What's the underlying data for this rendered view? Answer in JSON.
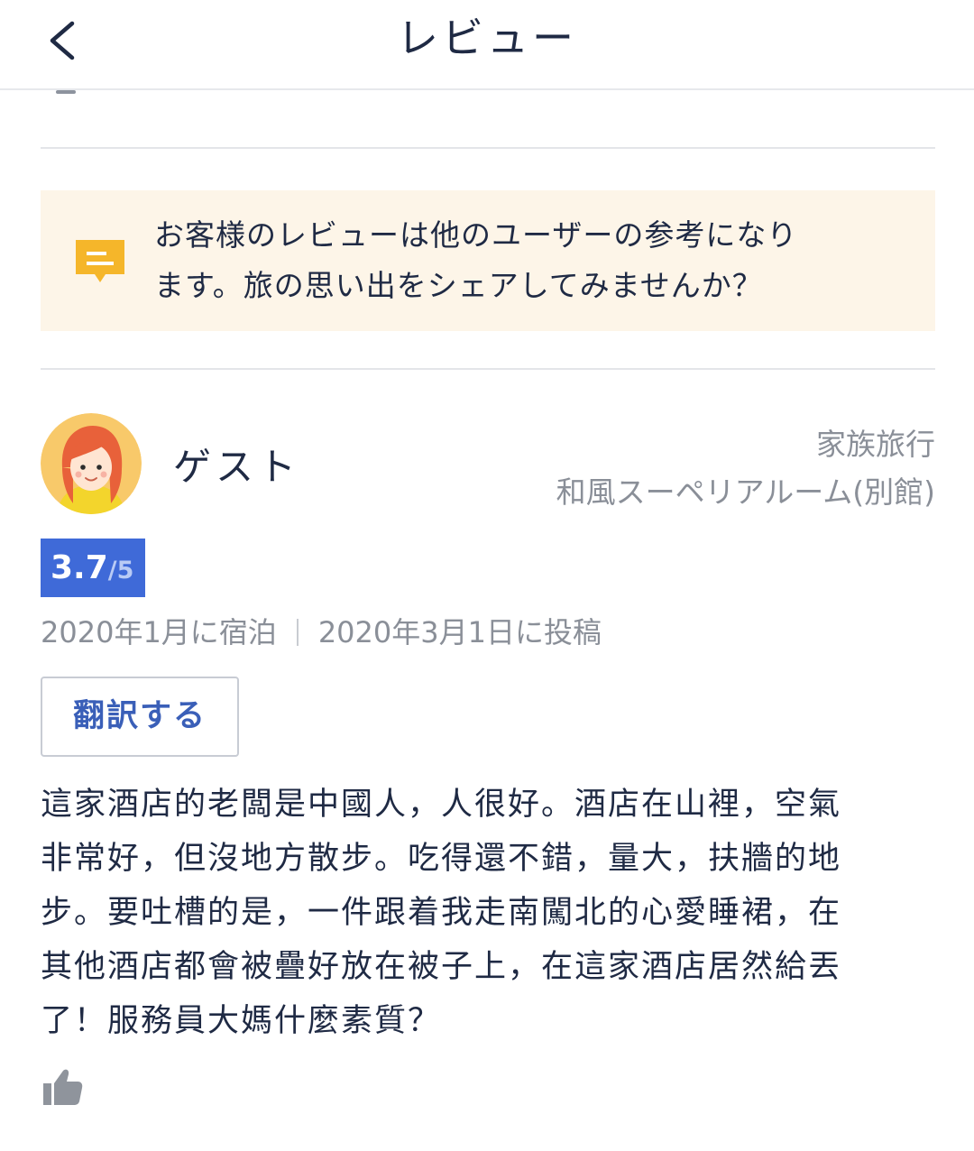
{
  "header": {
    "title": "レビュー",
    "back_icon": "chevron-left-icon"
  },
  "notice": {
    "icon": "message-icon",
    "icon_color": "#f5b62a",
    "background": "#fdf5e8",
    "line1": "お客様のレビューは他のユーザーの参考になり",
    "line2": "ます。旅の思い出をシェアしてみませんか？"
  },
  "review": {
    "user_name": "ゲスト",
    "trip_type": "家族旅行",
    "room_type": "和風スーペリアルーム(別館)",
    "score": "3.7",
    "score_max": "/5",
    "score_color": "#3f6ad8",
    "stay_date": "2020年1月に宿泊",
    "post_date": "2020年3月1日に投稿",
    "translate_label": "翻訳する",
    "lines": [
      "這家酒店的老闆是中國人，人很好。酒店在山裡，空氣",
      "非常好，但沒地方散步。吃得還不錯，量大，扶牆的地",
      "步。要吐槽的是，一件跟着我走南闖北的心愛睡裙，在",
      "其他酒店都會被疊好放在被子上，在這家酒店居然給丟",
      "了！服務員大媽什麼素質？"
    ],
    "like_icon": "thumbs-up-icon"
  }
}
